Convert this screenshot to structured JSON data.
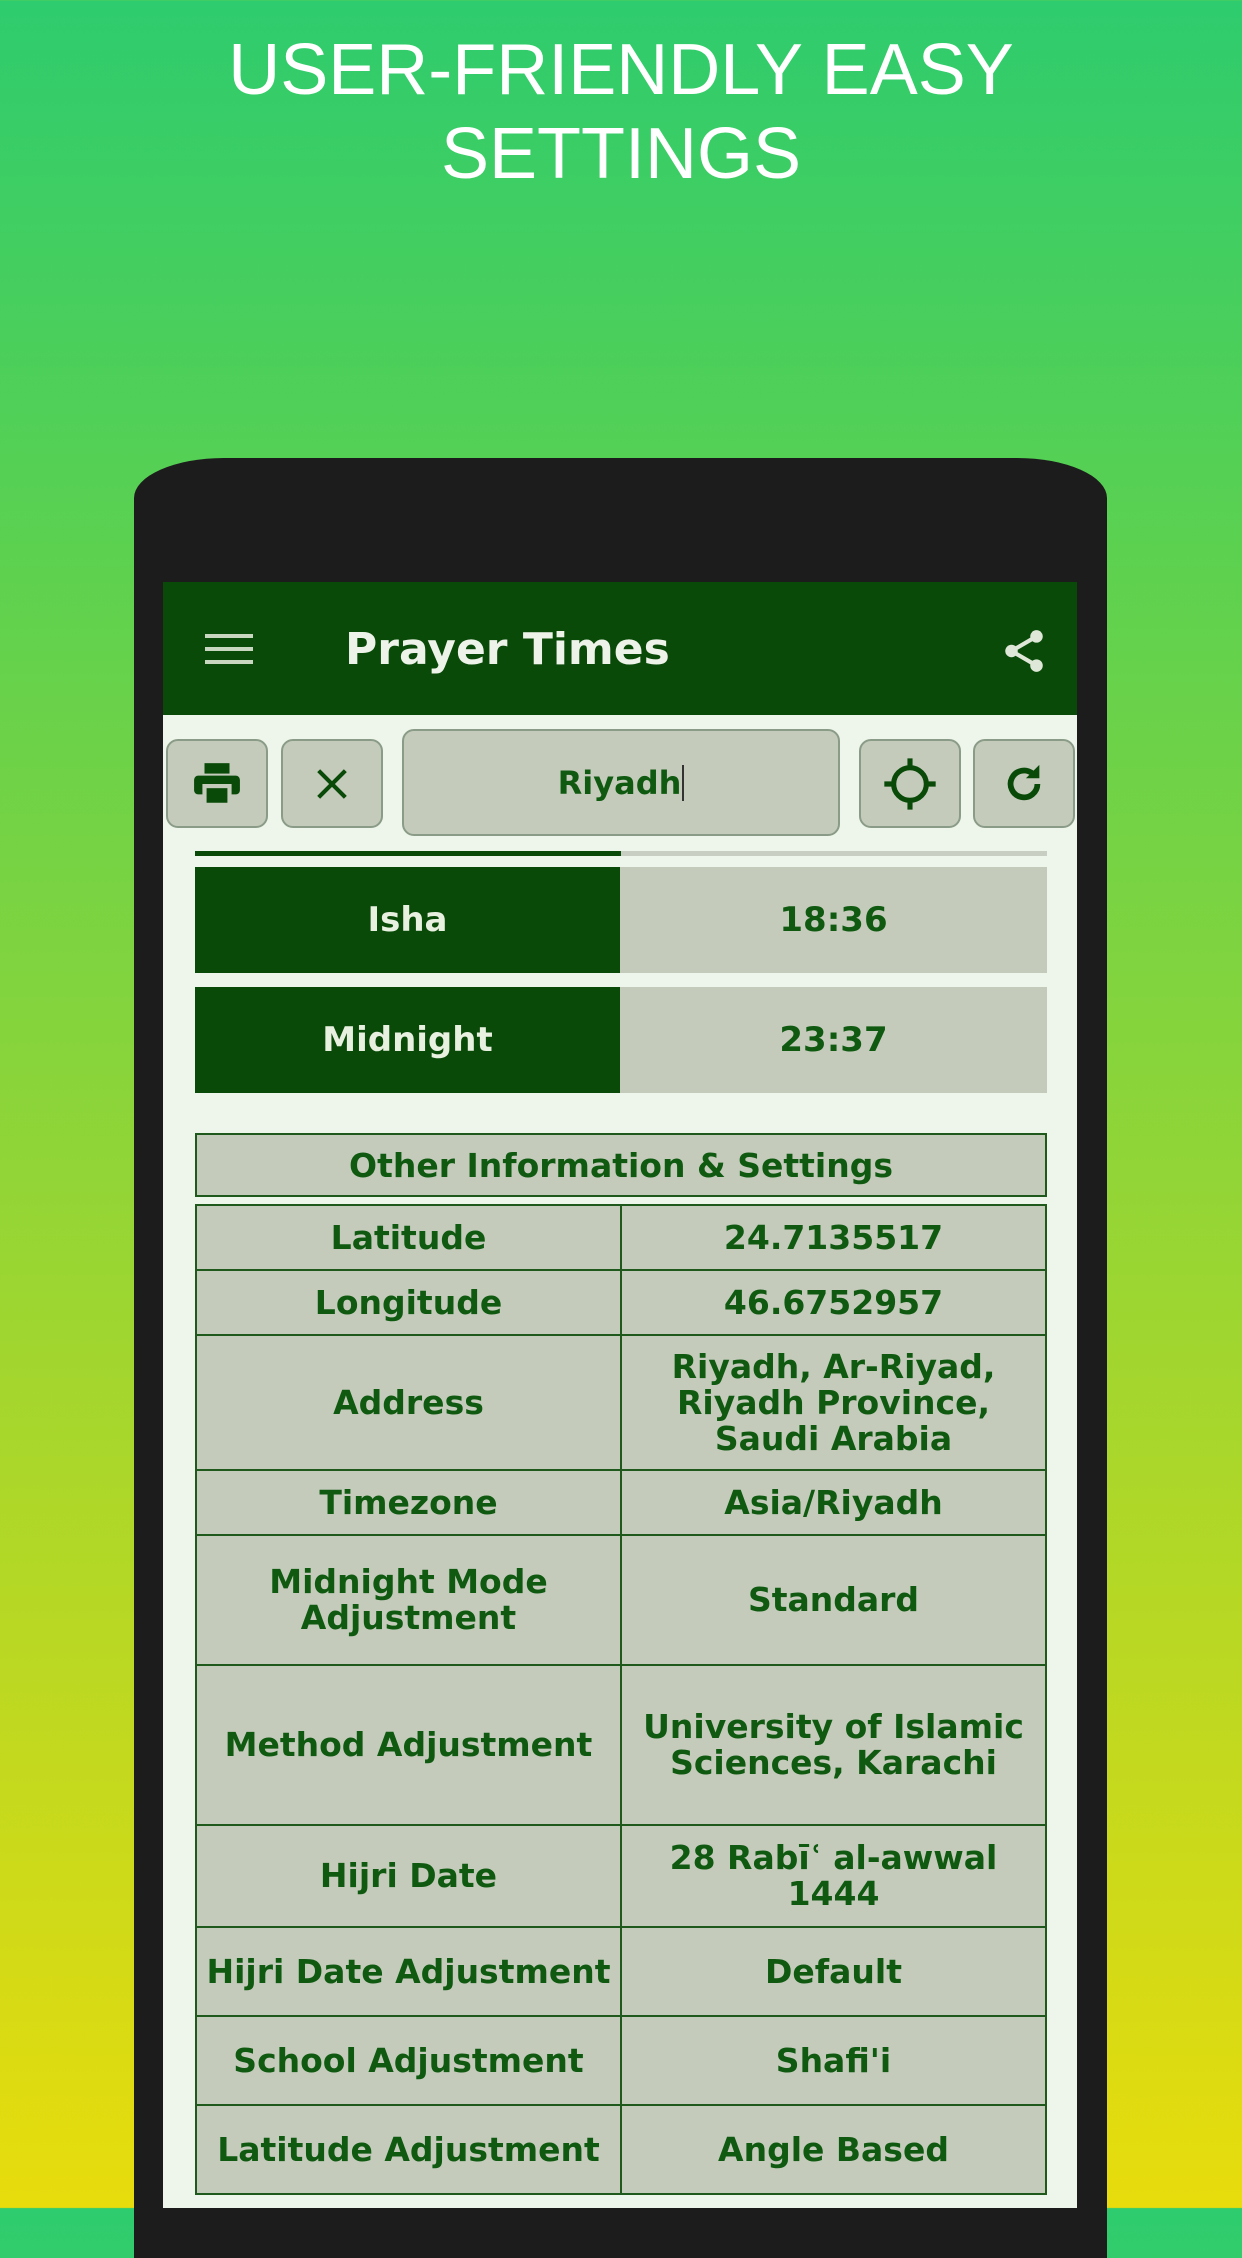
{
  "headline": [
    "USER-FRIENDLY EASY",
    "SETTINGS"
  ],
  "app": {
    "title": "Prayer Times",
    "menu_icon": "hamburger-icon",
    "share_icon": "share-icon"
  },
  "toolbar": {
    "search_value": "Riyadh",
    "print_icon": "print-icon",
    "clear_icon": "close-icon",
    "locate_icon": "gps-crosshair-icon",
    "refresh_icon": "refresh-icon"
  },
  "progress": 0.5,
  "prayers": [
    {
      "name": "Isha",
      "time": "18:36"
    },
    {
      "name": "Midnight",
      "time": "23:37"
    }
  ],
  "info": {
    "header": "Other Information & Settings",
    "rows": [
      {
        "label": "Latitude",
        "value": "24.7135517"
      },
      {
        "label": "Longitude",
        "value": "46.6752957"
      },
      {
        "label": "Address",
        "value": "Riyadh, Ar-Riyad, Riyadh Province, Saudi Arabia"
      },
      {
        "label": "Timezone",
        "value": "Asia/Riyadh"
      },
      {
        "label": "Midnight Mode Adjustment",
        "value": "Standard"
      },
      {
        "label": "Method Adjustment",
        "value": "University of Islamic Sciences, Karachi"
      },
      {
        "label": "Hijri Date",
        "value": "28 Rabīʿ al-awwal 1444"
      },
      {
        "label": "Hijri Date Adjustment",
        "value": "Default"
      },
      {
        "label": "School Adjustment",
        "value": "Shafi'i"
      },
      {
        "label": "Latitude Adjustment",
        "value": "Angle Based"
      }
    ]
  },
  "colors": {
    "primary": "#0a4a08",
    "cell": "#c4cbbb",
    "text": "#0f5a10"
  }
}
